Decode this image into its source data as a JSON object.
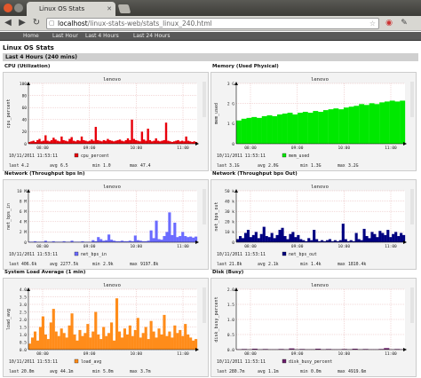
{
  "browser": {
    "tab_title": "Linux OS Stats",
    "url_host": "localhost",
    "url_path": "/linux-stats-web/stats_linux_240.html"
  },
  "nav": {
    "items": [
      "Home",
      "Last Hour",
      "Last 4 Hours",
      "Last 24 Hours"
    ]
  },
  "page": {
    "title": "Linux OS Stats",
    "section": "Last 4 Hours (240 mins)"
  },
  "colors": {
    "cpu": "#e8000b",
    "mem": "#00e800",
    "net_in": "#6b6bff",
    "net_out": "#000080",
    "load": "#ff8c1a",
    "disk": "#6b1f6b"
  },
  "chart_data": [
    {
      "type": "area",
      "panel_title": "CPU (Utilization)",
      "host": "lenovo",
      "ylabel": "cpu_percent",
      "yticks": [
        "100",
        "80",
        "60",
        "40",
        "20",
        "0"
      ],
      "ylim": [
        0,
        100
      ],
      "xticks": [
        "08:00",
        "09:00",
        "10:00",
        "11:00"
      ],
      "date": "10/11/2011 11:53:11",
      "series": [
        {
          "name": "cpu_percent",
          "values": [
            3,
            4,
            5,
            3,
            6,
            8,
            4,
            5,
            14,
            5,
            4,
            6,
            10,
            7,
            5,
            4,
            12,
            6,
            5,
            4,
            8,
            11,
            5,
            4,
            6,
            5,
            12,
            6,
            5,
            4,
            5,
            7,
            5,
            28,
            6,
            5,
            4,
            6,
            5,
            8,
            6,
            5,
            4,
            5,
            6,
            7,
            5,
            4,
            6,
            9,
            6,
            40,
            8,
            6,
            5,
            4,
            20,
            7,
            5,
            25,
            6,
            4,
            5,
            9,
            5,
            4,
            5,
            6,
            35,
            5,
            4,
            3,
            4,
            5,
            6,
            4,
            5,
            4,
            12,
            5,
            4,
            3,
            4,
            3
          ]
        }
      ],
      "stats": {
        "last": "4.2",
        "avg": "6.5",
        "min": "1.0",
        "max": "47.4"
      }
    },
    {
      "type": "area",
      "panel_title": "Memory (Used Physical)",
      "host": "lenovo",
      "ylabel": "mem_used",
      "yticks": [
        "3 G",
        "2 G",
        "1 G",
        "0"
      ],
      "ylim": [
        0,
        3.5
      ],
      "xticks": [
        "08:00",
        "09:00",
        "10:00",
        "11:00"
      ],
      "date": "10/11/2011 11:53:11",
      "series": [
        {
          "name": "mem_used",
          "values": [
            1.35,
            1.45,
            1.5,
            1.55,
            1.5,
            1.6,
            1.65,
            1.6,
            1.7,
            1.75,
            1.8,
            1.7,
            1.8,
            1.85,
            1.8,
            1.9,
            1.85,
            1.95,
            2.0,
            2.05,
            2.0,
            2.1,
            2.15,
            2.2,
            2.3,
            2.25,
            2.35,
            2.3,
            2.4,
            2.45,
            2.5,
            2.45,
            2.5
          ]
        }
      ],
      "stats": {
        "last": "3.1G",
        "avg": "2.0G",
        "min": "1.3G",
        "max": "3.2G"
      }
    },
    {
      "type": "area",
      "panel_title": "Network (Throughput bps In)",
      "host": "lenovo",
      "ylabel": "net_bps_in",
      "yticks": [
        "10 M",
        "8 M",
        "6 M",
        "4 M",
        "2 M",
        "0"
      ],
      "ylim": [
        0,
        10
      ],
      "xticks": [
        "08:00",
        "09:00",
        "10:00",
        "11:00"
      ],
      "date": "10/11/2011 11:53:11",
      "series": [
        {
          "name": "net_bps_in",
          "values": [
            0.1,
            0.1,
            0.2,
            0.1,
            0.1,
            0.1,
            0.3,
            0.1,
            0.1,
            0.2,
            0.1,
            0.1,
            0.1,
            0.2,
            0.1,
            0.1,
            0.3,
            0.1,
            0.1,
            0.1,
            0.2,
            0.1,
            0.1,
            0.1,
            0.4,
            0.2,
            1.0,
            0.6,
            0.3,
            0.4,
            1.5,
            0.5,
            0.3,
            0.2,
            0.2,
            0.3,
            0.2,
            0.2,
            0.3,
            0.2,
            1.3,
            0.4,
            0.3,
            0.2,
            0.2,
            0.3,
            2.3,
            0.8,
            4.2,
            0.6,
            0.5,
            1.2,
            2.0,
            5.8,
            1.4,
            3.8,
            1.0,
            1.2,
            2.0,
            1.2,
            1.0,
            1.1,
            0.9,
            1.1
          ]
        }
      ],
      "stats": {
        "last": "406.6k",
        "avg": "2277.5k",
        "min": "2.9k",
        "max": "9197.8k"
      }
    },
    {
      "type": "area",
      "panel_title": "Network (Throughput bps Out)",
      "host": "lenovo",
      "ylabel": "net_bps_out",
      "yticks": [
        "50 k",
        "40 k",
        "30 k",
        "20 k",
        "10 k",
        "0"
      ],
      "ylim": [
        0,
        50
      ],
      "xticks": [
        "08:00",
        "09:00",
        "10:00",
        "11:00"
      ],
      "date": "10/11/2011 11:53:11",
      "series": [
        {
          "name": "net_bps_out",
          "values": [
            3,
            6,
            4,
            9,
            12,
            5,
            7,
            10,
            4,
            8,
            15,
            6,
            5,
            9,
            4,
            7,
            12,
            14,
            6,
            3,
            8,
            10,
            5,
            7,
            3,
            2,
            1,
            4,
            2,
            12,
            3,
            1,
            2,
            1,
            2,
            3,
            1,
            2,
            1,
            2,
            18,
            3,
            1,
            2,
            1,
            9,
            3,
            2,
            13,
            6,
            4,
            10,
            8,
            5,
            11,
            9,
            7,
            12,
            5,
            8,
            10,
            6,
            9,
            7
          ]
        }
      ],
      "stats": {
        "last": "21.8k",
        "avg": "2.1k",
        "min": "1.4k",
        "max": "1810.4k"
      }
    },
    {
      "type": "area",
      "panel_title": "System Load Average (1 min)",
      "host": "lenovo",
      "ylabel": "load_avg",
      "yticks": [
        "4.0",
        "3.5",
        "3.0",
        "2.5",
        "2.0",
        "1.5",
        "1.0",
        "0.5",
        "0.0"
      ],
      "ylim": [
        0,
        4
      ],
      "xticks": [
        "08:00",
        "09:00",
        "10:00",
        "11:00"
      ],
      "date": "10/11/2011 11:53:11",
      "series": [
        {
          "name": "load_avg",
          "values": [
            0.4,
            0.8,
            1.2,
            0.6,
            1.5,
            2.2,
            1.0,
            0.7,
            1.8,
            2.7,
            1.2,
            0.9,
            1.4,
            1.1,
            0.8,
            1.6,
            2.4,
            1.0,
            0.6,
            1.3,
            0.9,
            1.1,
            1.7,
            0.8,
            1.2,
            2.5,
            1.0,
            0.7,
            1.5,
            0.9,
            1.1,
            1.8,
            0.6,
            3.4,
            1.2,
            0.8,
            1.4,
            1.0,
            1.6,
            0.9,
            1.3,
            2.1,
            0.8,
            1.1,
            1.5,
            0.7,
            1.9,
            1.2,
            0.8,
            1.4,
            1.0,
            2.3,
            0.9,
            1.2,
            0.8,
            1.6,
            1.1,
            1.3,
            0.9,
            1.7,
            1.0,
            0.8,
            0.6,
            0.7
          ]
        }
      ],
      "stats": {
        "last": "20.0m",
        "avg": "44.1m",
        "min": "5.0m",
        "max": "3.7m"
      }
    },
    {
      "type": "area",
      "panel_title": "Disk (Busy)",
      "host": "lenovo",
      "ylabel": "disk_busy_percent",
      "yticks": [
        "2.0",
        "1.5",
        "1.0",
        "0.5",
        "0.0"
      ],
      "ylim": [
        0,
        2
      ],
      "xticks": [
        "08:00",
        "09:00",
        "10:00",
        "11:00"
      ],
      "date": "10/11/2011 11:53:11",
      "series": [
        {
          "name": "disk_busy_percent",
          "values": [
            0.01,
            0.02,
            0.01,
            0.03,
            0.01,
            0.02,
            0.01,
            0.01,
            0.02,
            0.01,
            0.04,
            0.01,
            0.02,
            0.01,
            0.01,
            0.03,
            0.01,
            0.02,
            0.01,
            0.01,
            0.02,
            0.01,
            0.03,
            0.01,
            0.02,
            0.01,
            0.01,
            0.02,
            0.05,
            0.01,
            0.02,
            0.01
          ]
        }
      ],
      "stats": {
        "last": "280.7m",
        "avg": "1.1m",
        "min": "0.0m",
        "max": "4919.6m"
      }
    }
  ]
}
